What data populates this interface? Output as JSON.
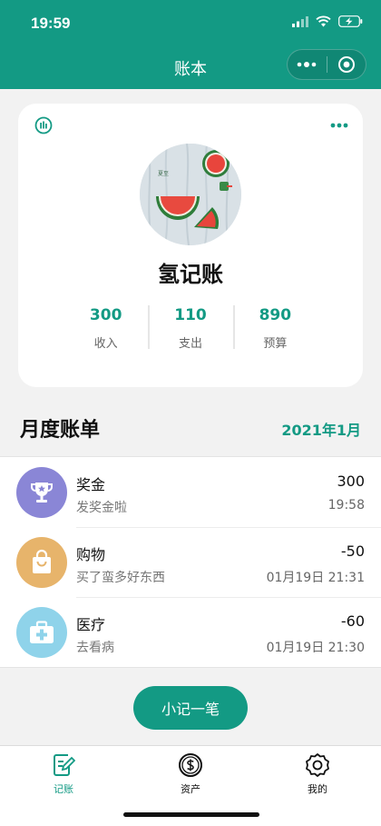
{
  "status_bar": {
    "time": "19:59"
  },
  "nav": {
    "title": "账本"
  },
  "book": {
    "name": "氢记账",
    "stats": [
      {
        "value": "300",
        "label": "收入"
      },
      {
        "value": "110",
        "label": "支出"
      },
      {
        "value": "890",
        "label": "预算"
      }
    ]
  },
  "section": {
    "title": "月度账单",
    "date": "2021年1月"
  },
  "transactions": [
    {
      "title": "奖金",
      "note": "发奖金啦",
      "amount": "300",
      "time": "19:58",
      "icon": "trophy-icon",
      "color": "#8a86d6"
    },
    {
      "title": "购物",
      "note": "买了蛮多好东西",
      "amount": "-50",
      "time": "01月19日 21:31",
      "icon": "shopping-bag-icon",
      "color": "#e7b46b"
    },
    {
      "title": "医疗",
      "note": "去看病",
      "amount": "-60",
      "time": "01月19日 21:30",
      "icon": "medical-kit-icon",
      "color": "#8fd3ea"
    }
  ],
  "add_button": {
    "label": "小记一笔"
  },
  "tabs": [
    {
      "label": "记账",
      "icon": "note-edit-icon",
      "active": true
    },
    {
      "label": "资产",
      "icon": "dollar-coin-icon",
      "active": false
    },
    {
      "label": "我的",
      "icon": "settings-icon",
      "active": false
    }
  ],
  "colors": {
    "primary": "#139a84",
    "background": "#f2f2f2"
  }
}
